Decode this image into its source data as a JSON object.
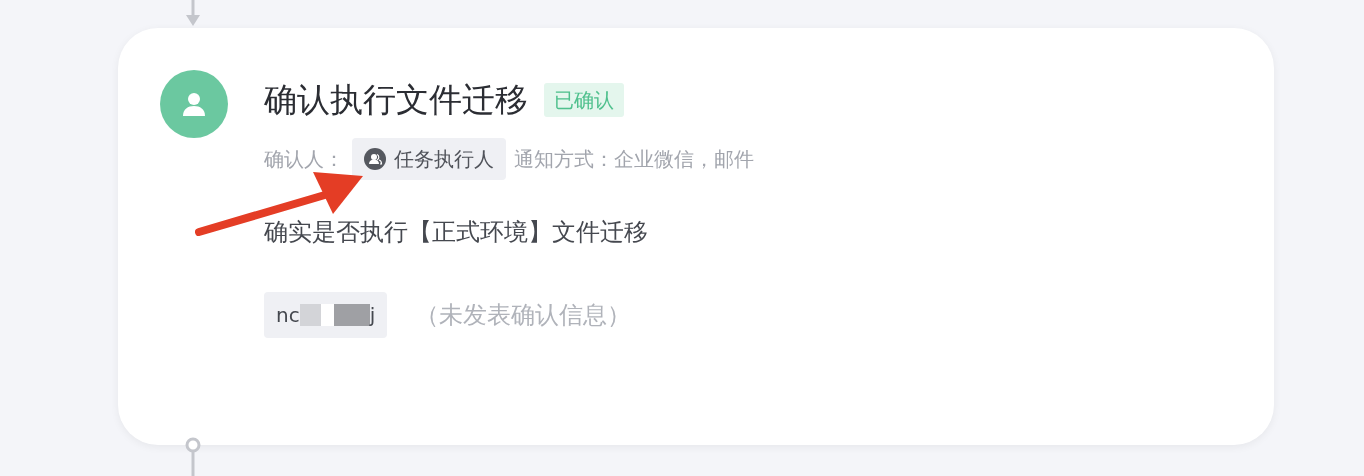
{
  "step": {
    "title": "确认执行文件迁移",
    "status": {
      "text": "已确认",
      "kind": "confirmed"
    },
    "confirmer_label": "确认人：",
    "confirmer": "任务执行人",
    "notify_label": "通知方式：",
    "notify_value": "企业微信，邮件",
    "description": "确实是否执行【正式环境】文件迁移",
    "user": {
      "name_start": "nc",
      "name_end": "j"
    },
    "user_comment": "（未发表确认信息）"
  }
}
